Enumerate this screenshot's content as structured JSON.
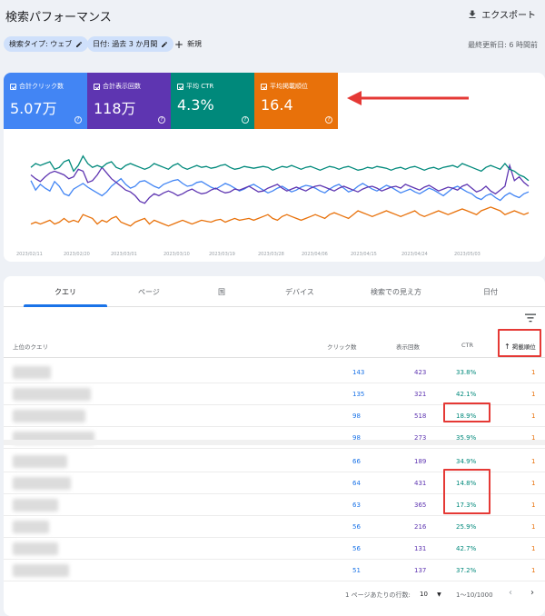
{
  "header": {
    "title": "検索パフォーマンス",
    "export_label": "エクスポート"
  },
  "filters": {
    "chip_search_type": "検索タイプ: ウェブ",
    "chip_date": "日付: 過去 3 か月間",
    "new_label": "新規",
    "updated": "最終更新日: 6 時間前"
  },
  "metrics": {
    "clicks": {
      "label": "合計クリック数",
      "value": "5.07万"
    },
    "impressions": {
      "label": "合計表示回数",
      "value": "118万"
    },
    "ctr": {
      "label": "平均 CTR",
      "value": "4.3%"
    },
    "position": {
      "label": "平均掲載順位",
      "value": "16.4"
    }
  },
  "chart_data": {
    "type": "line",
    "x_ticks": [
      "2023/02/11",
      "2023/02/20",
      "2023/03/01",
      "2023/03/10",
      "2023/03/19",
      "2023/03/28",
      "2023/04/06",
      "2023/04/15",
      "2023/04/24",
      "2023/05/03"
    ],
    "series": [
      {
        "name": "合計クリック数",
        "color": "#4285f4",
        "values": [
          44,
          54,
          48,
          52,
          55,
          45,
          50,
          58,
          60,
          53,
          50,
          47,
          51,
          54,
          57,
          60,
          56,
          50,
          46,
          42,
          48,
          52,
          50,
          45,
          44,
          47,
          50,
          52,
          48,
          46,
          44,
          43,
          47,
          50,
          49,
          46,
          45,
          48,
          51,
          53,
          50,
          47,
          49,
          52,
          55,
          53,
          50,
          48,
          51,
          54,
          57,
          55,
          52,
          50,
          53,
          56,
          54,
          51,
          49,
          50,
          52,
          55,
          57,
          53,
          50,
          48,
          52,
          56,
          54,
          50,
          47,
          50,
          53,
          55,
          52,
          49,
          51,
          54,
          57,
          55,
          53,
          56,
          58,
          55,
          52,
          54,
          57,
          60,
          56,
          52,
          50,
          53,
          56,
          58,
          62,
          64,
          60,
          58,
          62,
          65,
          60,
          57,
          60,
          62,
          58,
          56
        ]
      },
      {
        "name": "合計表示回数",
        "color": "#5e35b1",
        "values": [
          38,
          42,
          45,
          40,
          36,
          34,
          36,
          38,
          42,
          40,
          32,
          34,
          46,
          44,
          38,
          30,
          36,
          42,
          46,
          50,
          54,
          56,
          60,
          66,
          68,
          62,
          58,
          60,
          57,
          55,
          57,
          60,
          58,
          55,
          53,
          56,
          58,
          57,
          54,
          52,
          55,
          57,
          56,
          53,
          54,
          52,
          50,
          53,
          56,
          55,
          52,
          50,
          48,
          52,
          55,
          53,
          51,
          53,
          55,
          52,
          50,
          49,
          51,
          53,
          55,
          52,
          50,
          52,
          54,
          56,
          53,
          51,
          50,
          52,
          55,
          53,
          51,
          50,
          52,
          48,
          50,
          52,
          54,
          51,
          49,
          52,
          55,
          53,
          51,
          52,
          54,
          50,
          48,
          52,
          56,
          54,
          50,
          55,
          58,
          54,
          50,
          28,
          44,
          40,
          46,
          50
        ]
      },
      {
        "name": "平均 CTR",
        "color": "#00897b",
        "values": [
          30,
          26,
          28,
          26,
          24,
          32,
          30,
          24,
          22,
          34,
          28,
          18,
          26,
          30,
          28,
          30,
          26,
          24,
          30,
          32,
          28,
          26,
          28,
          30,
          32,
          30,
          26,
          28,
          30,
          32,
          28,
          26,
          30,
          32,
          30,
          28,
          30,
          29,
          31,
          30,
          28,
          27,
          30,
          32,
          31,
          29,
          30,
          31,
          30,
          29,
          30,
          33,
          31,
          29,
          30,
          28,
          30,
          32,
          30,
          29,
          31,
          33,
          31,
          29,
          30,
          32,
          30,
          29,
          31,
          33,
          32,
          30,
          31,
          29,
          30,
          31,
          33,
          31,
          30,
          32,
          30,
          29,
          31,
          33,
          31,
          30,
          32,
          30,
          29,
          28,
          30,
          26,
          28,
          30,
          32,
          34,
          30,
          28,
          30,
          32,
          26,
          32,
          34,
          38,
          40,
          44
        ]
      },
      {
        "name": "平均掲載順位",
        "color": "#e8710a",
        "values": [
          90,
          88,
          90,
          88,
          86,
          90,
          88,
          84,
          88,
          86,
          88,
          80,
          82,
          84,
          90,
          86,
          88,
          84,
          82,
          88,
          90,
          92,
          88,
          86,
          84,
          90,
          86,
          88,
          90,
          92,
          90,
          88,
          86,
          88,
          90,
          88,
          86,
          87,
          88,
          86,
          85,
          88,
          86,
          84,
          86,
          85,
          84,
          86,
          84,
          82,
          80,
          84,
          86,
          82,
          80,
          82,
          84,
          86,
          84,
          82,
          80,
          82,
          84,
          80,
          78,
          80,
          82,
          84,
          80,
          76,
          78,
          80,
          82,
          80,
          78,
          76,
          78,
          80,
          82,
          80,
          78,
          76,
          80,
          82,
          80,
          78,
          76,
          78,
          80,
          78,
          76,
          74,
          76,
          78,
          80,
          76,
          74,
          72,
          74,
          76,
          80,
          78,
          76,
          78,
          80,
          78
        ]
      }
    ]
  },
  "tabs": [
    "クエリ",
    "ページ",
    "国",
    "デバイス",
    "検索での見え方",
    "日付"
  ],
  "table": {
    "headers": {
      "query": "上位のクエリ",
      "clicks": "クリック数",
      "impressions": "表示回数",
      "ctr": "CTR",
      "position": "掲載順位"
    },
    "rows": [
      {
        "clicks": "143",
        "impressions": "423",
        "ctr": "33.8%",
        "position": "1"
      },
      {
        "clicks": "135",
        "impressions": "321",
        "ctr": "42.1%",
        "position": "1"
      },
      {
        "clicks": "98",
        "impressions": "518",
        "ctr": "18.9%",
        "position": "1"
      },
      {
        "clicks": "98",
        "impressions": "273",
        "ctr": "35.9%",
        "position": "1"
      },
      {
        "clicks": "66",
        "impressions": "189",
        "ctr": "34.9%",
        "position": "1"
      },
      {
        "clicks": "64",
        "impressions": "431",
        "ctr": "14.8%",
        "position": "1"
      },
      {
        "clicks": "63",
        "impressions": "365",
        "ctr": "17.3%",
        "position": "1"
      },
      {
        "clicks": "56",
        "impressions": "216",
        "ctr": "25.9%",
        "position": "1"
      },
      {
        "clicks": "56",
        "impressions": "131",
        "ctr": "42.7%",
        "position": "1"
      },
      {
        "clicks": "51",
        "impressions": "137",
        "ctr": "37.2%",
        "position": "1"
      }
    ]
  },
  "pagination": {
    "rows_label": "1 ページあたりの行数:",
    "rows_value": "10",
    "range": "1～10/1000"
  }
}
